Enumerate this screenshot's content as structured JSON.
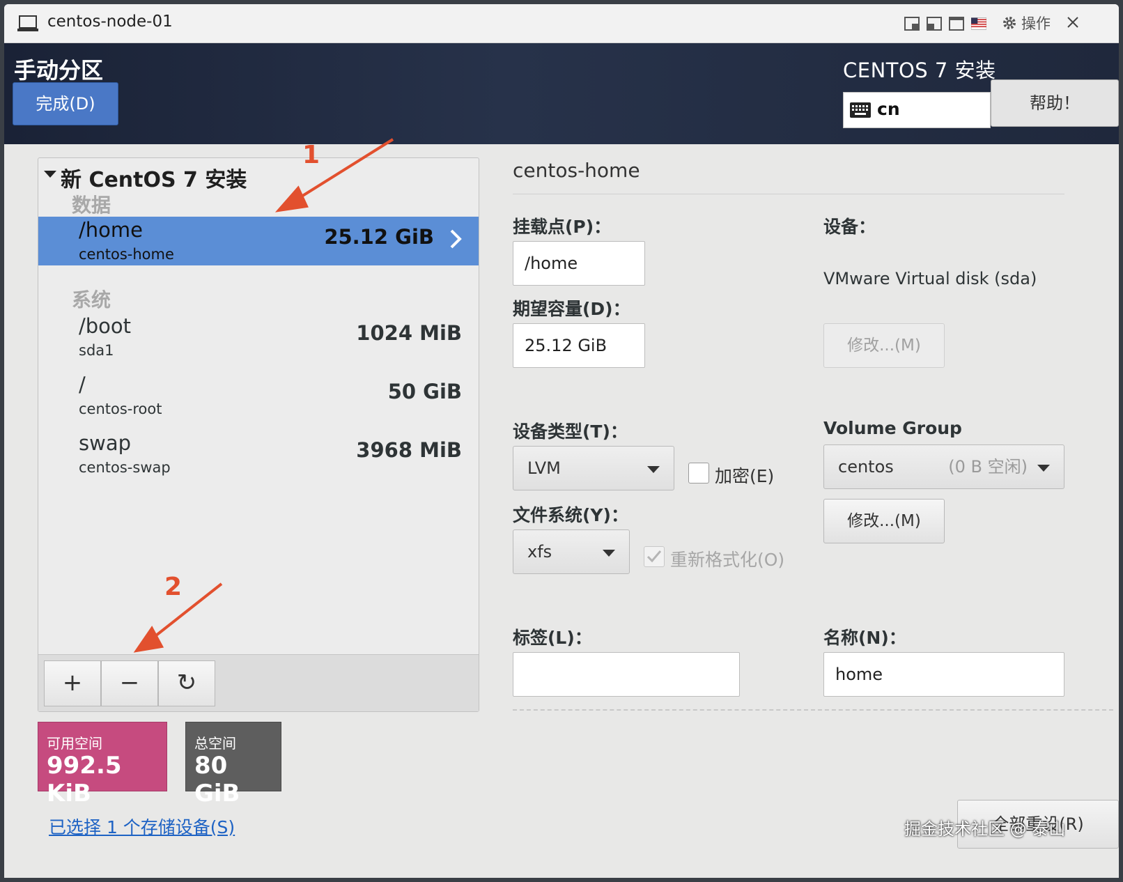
{
  "window": {
    "title": "centos-node-01",
    "actions_label": "操作"
  },
  "header": {
    "spoke_title": "手动分区",
    "done_label": "完成(D)",
    "product_title": "CENTOS 7 安装",
    "keyboard_layout": "cn",
    "help_label": "帮助！"
  },
  "partitions": {
    "group_title": "新 CentOS 7 安装",
    "sections": [
      {
        "label": "数据",
        "items": [
          {
            "mount": "/home",
            "device": "centos-home",
            "size": "25.12 GiB",
            "selected": true
          }
        ]
      },
      {
        "label": "系统",
        "items": [
          {
            "mount": "/boot",
            "device": "sda1",
            "size": "1024 MiB"
          },
          {
            "mount": "/",
            "device": "centos-root",
            "size": "50 GiB"
          },
          {
            "mount": "swap",
            "device": "centos-swap",
            "size": "3968 MiB"
          }
        ]
      }
    ],
    "toolbar": {
      "add": "+",
      "remove": "−",
      "refresh": "↻"
    }
  },
  "space": {
    "available_label": "可用空间",
    "available_value": "992.5 KiB",
    "total_label": "总空间",
    "total_value": "80 GiB"
  },
  "storage_link": "已选择 1 个存储设备(S)",
  "details": {
    "title": "centos-home",
    "mount_point_label": "挂载点(P)：",
    "mount_point_value": "/home",
    "capacity_label": "期望容量(D)：",
    "capacity_value": "25.12 GiB",
    "device_label": "设备：",
    "device_value": "VMware Virtual disk (sda)",
    "modify_label": "修改...(M)",
    "device_type_label": "设备类型(T)：",
    "device_type_value": "LVM",
    "encrypt_label": "加密(E)",
    "volume_group_label": "Volume Group",
    "volume_group_value": "centos",
    "volume_group_free": "(0 B 空闲)",
    "filesystem_label": "文件系统(Y)：",
    "filesystem_value": "xfs",
    "reformat_label": "重新格式化(O)",
    "tag_label": "标签(L)：",
    "tag_value": "",
    "name_label": "名称(N)：",
    "name_value": "home",
    "reset_all_label": "全部重设(R)"
  },
  "annotations": {
    "first": "1",
    "second": "2"
  },
  "watermark": "掘金技术社区 @ 泰山"
}
